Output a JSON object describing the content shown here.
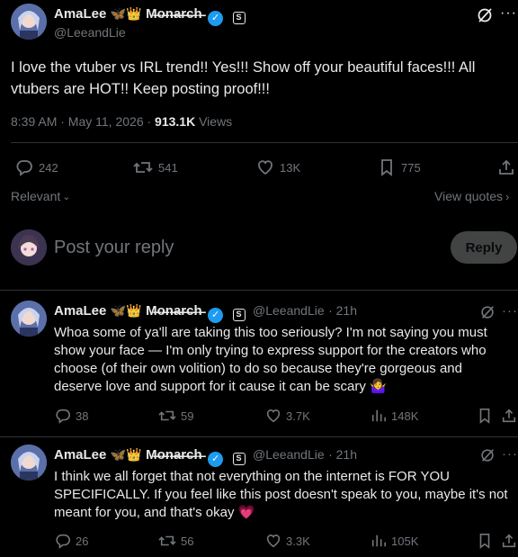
{
  "main_post": {
    "author": {
      "display_name": "AmaLee",
      "decorations": "🦋👑",
      "monarch": "M̶o̶n̶a̶r̶c̶h̶",
      "handle": "@LeeandLie"
    },
    "text": "I love the vtuber vs IRL trend!! Yes!!! Show off your beautiful faces!!! All vtubers are HOT!! Keep posting proof!!!",
    "timestamp": "8:39 AM · May 11, 2026 ·",
    "views_count": "913.1K",
    "views_label": "Views",
    "stats": {
      "replies": "242",
      "reposts": "541",
      "likes": "13K",
      "bookmarks": "775"
    }
  },
  "sort": {
    "label": "Relevant",
    "view_quotes": "View quotes"
  },
  "reply_box": {
    "placeholder": "Post your reply",
    "button": "Reply"
  },
  "replies": [
    {
      "display_name": "AmaLee",
      "decorations": "🦋👑",
      "monarch": "M̶o̶n̶a̶r̶c̶h̶",
      "handle": "@LeeandLie",
      "age": "· 21h",
      "text": "Whoa some of ya'll are taking this too seriously? I'm not saying you must show your face — I'm only trying to express support for the creators who choose (of their own volition) to do so because they're gorgeous and deserve love and support for it cause it can be scary 🤷‍♀️",
      "stats": {
        "replies": "38",
        "reposts": "59",
        "likes": "3.7K",
        "views": "148K"
      }
    },
    {
      "display_name": "AmaLee",
      "decorations": "🦋👑",
      "monarch": "M̶o̶n̶a̶r̶c̶h̶",
      "handle": "@LeeandLie",
      "age": "· 21h",
      "text": "I think we all forget that not everything on the internet is FOR YOU SPECIFICALLY. If you feel like this post doesn't speak to you, maybe it's not meant for you, and that's okay 💗",
      "stats": {
        "replies": "26",
        "reposts": "56",
        "likes": "3.3K",
        "views": "105K"
      }
    }
  ],
  "colors": {
    "background": "#000000",
    "text": "#e7e9ea",
    "muted": "#71767b",
    "divider": "#2f3336",
    "verified": "#1d9bf0"
  }
}
